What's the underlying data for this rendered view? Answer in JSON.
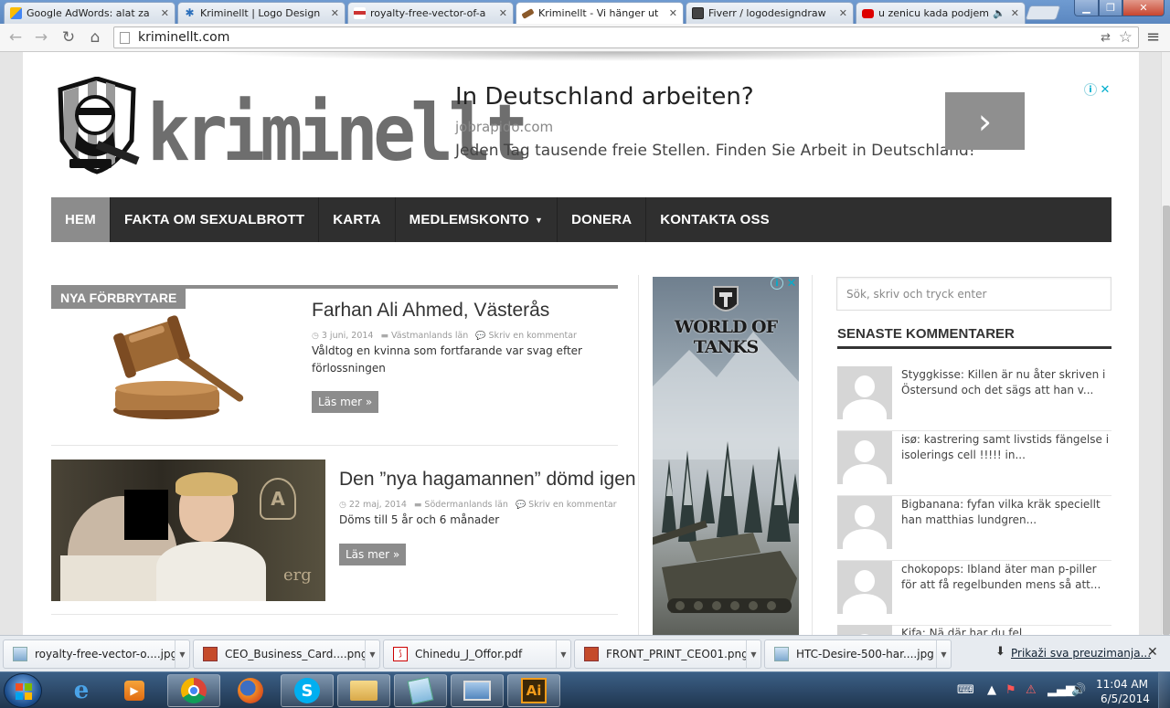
{
  "browser": {
    "tabs": [
      {
        "title": "Google AdWords: alat za",
        "favicon": "adwords-icon",
        "color": "#4285f4"
      },
      {
        "title": "Kriminellt | Logo Design",
        "favicon": "gear-icon",
        "color": "#2a6ebb"
      },
      {
        "title": "royalty-free-vector-of-a",
        "favicon": "image-icon",
        "color": "#c33"
      },
      {
        "title": "Kriminellt - Vi hänger ut",
        "favicon": "gavel-icon",
        "color": "#8b5a2b",
        "active": true
      },
      {
        "title": "Fiverr / logodesigndraw",
        "favicon": "fiverr-icon",
        "color": "#333"
      },
      {
        "title": "u zenicu kada podjem",
        "favicon": "youtube-icon",
        "color": "#d00"
      }
    ],
    "url": "kriminellt.com"
  },
  "header": {
    "logo_text": "kriminellt",
    "ad": {
      "title": "In Deutschland arbeiten?",
      "url": "jobrapido.com",
      "description": "Jeden Tag tausende freie Stellen. Finden Sie Arbeit in Deutschland!",
      "arrow": "›"
    }
  },
  "nav": {
    "items": [
      {
        "label": "HEM",
        "active": true
      },
      {
        "label": "FAKTA OM SEXUALBROTT"
      },
      {
        "label": "KARTA"
      },
      {
        "label": "MEDLEMSKONTO",
        "dropdown": true
      },
      {
        "label": "DONERA"
      },
      {
        "label": "KONTAKTA OSS"
      }
    ]
  },
  "section_label": "NYA FÖRBRYTARE",
  "posts": [
    {
      "title": "Farhan Ali Ahmed, Västerås",
      "date": "3 juni, 2014",
      "category": "Västmanlands län",
      "comments": "Skriv en kommentar",
      "excerpt": "Våldtog en kvinna som fortfarande var svag efter förlossningen",
      "readmore": "Läs mer »"
    },
    {
      "title": "Den ”nya hagamannen” dömd igen",
      "date": "22 maj, 2014",
      "category": "Södermanlands län",
      "comments": "Skriv en kommentar",
      "excerpt": "Döms till 5 år och 6 månader",
      "readmore": "Läs mer »",
      "photo_text": "erg"
    }
  ],
  "middle_ad": {
    "brand": "WORLD OF TANKS",
    "brand_small": "of"
  },
  "sidebar": {
    "search_placeholder": "Sök, skriv och tryck enter",
    "recent_title": "SENASTE KOMMENTARER",
    "comments": [
      {
        "text": "Styggkisse: Killen är nu åter skriven i Östersund och det sägs att han v..."
      },
      {
        "text": "isø: kastrering samt livstids fängelse i isolerings cell !!!!! in..."
      },
      {
        "text": "Bigbanana: fyfan vilka kräk speciellt han matthias lundgren..."
      },
      {
        "text": "chokopops: Ibland äter man p-piller för att få regelbunden mens så att..."
      },
      {
        "text": "Kifa: Nä där har du fel"
      }
    ]
  },
  "downloads": {
    "items": [
      {
        "name": "royalty-free-vector-o....jpg",
        "icon": "image-file-icon"
      },
      {
        "name": "CEO_Business_Card....png",
        "icon": "png-file-icon"
      },
      {
        "name": "Chinedu_J_Offor.pdf",
        "icon": "pdf-file-icon"
      },
      {
        "name": "FRONT_PRINT_CEO01.png",
        "icon": "png-file-icon"
      },
      {
        "name": "HTC-Desire-500-har....jpg",
        "icon": "image-file-icon"
      }
    ],
    "show_all": "Prikaži sva preuzimanja..."
  },
  "taskbar": {
    "apps": [
      "internet-explorer-icon",
      "media-player-icon",
      "chrome-icon",
      "firefox-icon",
      "skype-icon",
      "file-explorer-icon",
      "notepad-icon",
      "screen-icon",
      "illustrator-icon"
    ],
    "illustrator_label": "Ai",
    "time": "11:04 AM",
    "date": "6/5/2014"
  }
}
